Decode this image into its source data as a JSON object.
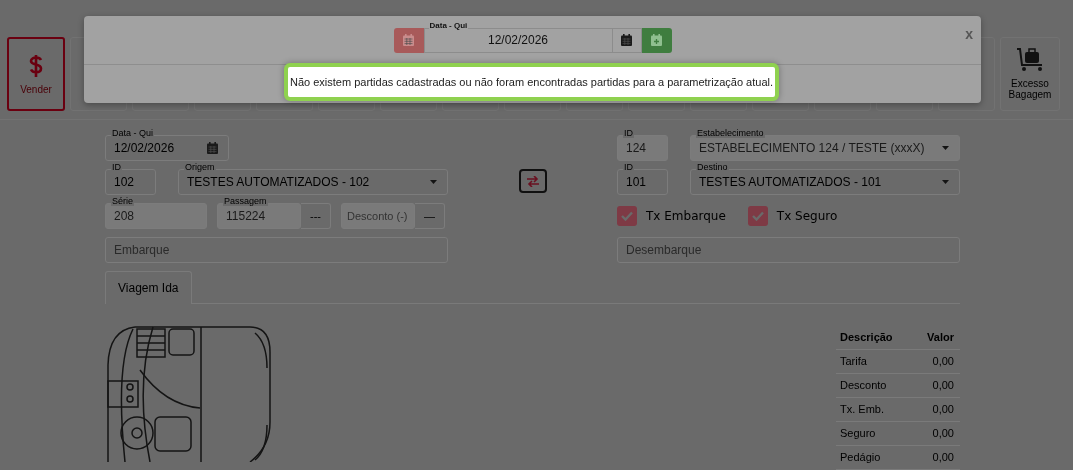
{
  "toolbar": {
    "buttons": [
      {
        "kind": "sell",
        "label": "Vender",
        "selected": true
      },
      {
        "kind": "covered"
      },
      {
        "kind": "covered"
      },
      {
        "kind": "covered"
      },
      {
        "kind": "covered"
      },
      {
        "kind": "covered"
      },
      {
        "kind": "covered"
      },
      {
        "kind": "covered"
      },
      {
        "kind": "covered"
      },
      {
        "kind": "covered"
      },
      {
        "kind": "covered"
      },
      {
        "kind": "covered"
      },
      {
        "kind": "covered"
      },
      {
        "kind": "covered"
      },
      {
        "kind": "covered"
      },
      {
        "kind": "covered"
      },
      {
        "kind": "baggage",
        "label": "Excesso Bagagem",
        "selected": false
      }
    ]
  },
  "form": {
    "date": {
      "label": "Data - Qui",
      "value": "12/02/2026"
    },
    "origin": {
      "id_label": "ID",
      "id": "102",
      "label": "Origem",
      "value": "TESTES AUTOMATIZADOS - 102"
    },
    "series": {
      "label": "Série",
      "value": "208"
    },
    "ticket": {
      "label": "Passagem",
      "value": "115224",
      "button": "---"
    },
    "discount": {
      "placeholder": "Desconto (-)",
      "button": "—",
      "disabled": true
    },
    "boarding": {
      "placeholder": "Embarque"
    },
    "establishment": {
      "id_label": "ID",
      "id": "124",
      "label": "Estabelecimento",
      "value": "ESTABELECIMENTO 124 / TESTE (xxxX)",
      "disabled": true
    },
    "destination": {
      "id_label": "ID",
      "id": "101",
      "label": "Destino",
      "value": "TESTES AUTOMATIZADOS - 101"
    },
    "options": [
      {
        "label": "Tx Embarque",
        "checked": true
      },
      {
        "label": "Tx Seguro",
        "checked": true
      }
    ],
    "landing": {
      "placeholder": "Desembarque"
    }
  },
  "tabs": [
    {
      "label": "Viagem Ida",
      "selected": true
    }
  ],
  "price_table": {
    "columns": [
      "Descrição",
      "Valor"
    ],
    "rows": [
      [
        "Tarifa",
        "0,00"
      ],
      [
        "Desconto",
        "0,00"
      ],
      [
        "Tx. Emb.",
        "0,00"
      ],
      [
        "Seguro",
        "0,00"
      ],
      [
        "Pedágio",
        "0,00"
      ]
    ]
  },
  "modal": {
    "date": {
      "label": "Data - Qui",
      "value": "12/02/2026"
    },
    "close": "x",
    "toast": "Não existem partidas cadastradas ou não foram encontradas partidas para a parametrização atual."
  }
}
